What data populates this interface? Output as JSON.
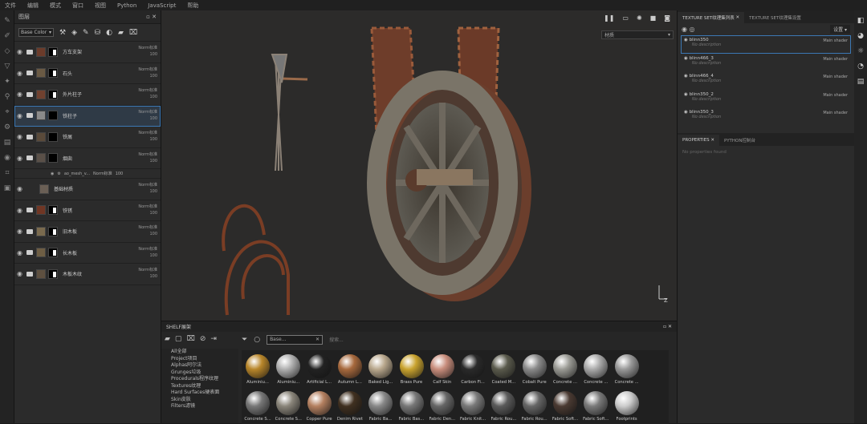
{
  "menu": [
    "文件",
    "编辑",
    "模式",
    "窗口",
    "视图",
    "Python",
    "JavaScript",
    "帮助"
  ],
  "layers": {
    "title": "图层",
    "channel": "Base Color",
    "items": [
      {
        "name": "方车支架",
        "blend": "Norm标准",
        "op": "100",
        "thumb": "#6b3b2a",
        "mask": "white"
      },
      {
        "name": "石头",
        "blend": "Norm标准",
        "op": "100",
        "thumb": "#6a5a44",
        "mask": "white"
      },
      {
        "name": "外片柱子",
        "blend": "Norm标准",
        "op": "100",
        "thumb": "#70412f",
        "mask": "white"
      },
      {
        "name": "铁柱子",
        "blend": "Norm标准",
        "op": "100",
        "thumb": "#8a8a8a",
        "mask": "black"
      },
      {
        "name": "铁屑",
        "blend": "Norm标准",
        "op": "100",
        "thumb": "#5a4a3a",
        "mask": "black"
      },
      {
        "name": "烟囱",
        "blend": "Norm标准",
        "op": "100",
        "thumb": "#5a5048",
        "mask": "black"
      },
      {
        "name": "基础材质",
        "blend": "Norm标准",
        "op": "100",
        "thumb": "#6a5f55",
        "mask": "none"
      },
      {
        "name": "铁锈",
        "blend": "Norm标准",
        "op": "100",
        "thumb": "#703624",
        "mask": "white"
      },
      {
        "name": "旧木板",
        "blend": "Norm标准",
        "op": "100",
        "thumb": "#7a6a4e",
        "mask": "white"
      },
      {
        "name": "长木板",
        "blend": "Norm标准",
        "op": "100",
        "thumb": "#6e5e44",
        "mask": "white"
      },
      {
        "name": "木板木纹",
        "blend": "Norm标准",
        "op": "100",
        "thumb": "#5e5040",
        "mask": "white"
      }
    ],
    "sublayer": {
      "name": "ao_mesh_v...",
      "blend": "Norm标准",
      "op": "100"
    }
  },
  "viewport": {
    "dropdown": "材质"
  },
  "shelf": {
    "title": "SHELF展架",
    "search": "搜索...",
    "filter": "Base...",
    "categories": [
      "All全部",
      "Project项目",
      "Alphas阿尔法",
      "Grunges垃圾",
      "Procedurals程序纹理",
      "Textures纹理",
      "Hard Surfaces硬表面",
      "Skin皮肤",
      "Filters滤镜"
    ],
    "materials": [
      {
        "name": "Aluminiu...",
        "c": "#b8862a"
      },
      {
        "name": "Aluminiu...",
        "c": "#b0b0b0"
      },
      {
        "name": "Artificial L...",
        "c": "#222"
      },
      {
        "name": "Autumn L...",
        "c": "#a7693d"
      },
      {
        "name": "Baked Lig...",
        "c": "#b9a88d"
      },
      {
        "name": "Brass Pure",
        "c": "#c9a32f"
      },
      {
        "name": "Calf Skin",
        "c": "#c88d7c"
      },
      {
        "name": "Carbon Fi...",
        "c": "#2a2a2a"
      },
      {
        "name": "Coated M...",
        "c": "#5a5a4c"
      },
      {
        "name": "Cobalt Pure",
        "c": "#8a8a8a"
      },
      {
        "name": "Concrete ...",
        "c": "#9a9a94"
      },
      {
        "name": "Concrete ...",
        "c": "#aaa"
      },
      {
        "name": "Concrete ...",
        "c": "#999"
      },
      {
        "name": "Concrete S...",
        "c": "#777"
      },
      {
        "name": "Concrete S...",
        "c": "#8a857a"
      },
      {
        "name": "Copper Pure",
        "c": "#b48060"
      },
      {
        "name": "Denim Rivet",
        "c": "#403020"
      },
      {
        "name": "Fabric Ba...",
        "c": "#888"
      },
      {
        "name": "Fabric Bas...",
        "c": "#777"
      },
      {
        "name": "Fabric Den...",
        "c": "#666"
      },
      {
        "name": "Fabric Knit...",
        "c": "#797979"
      },
      {
        "name": "Fabric Rou...",
        "c": "#5a5a5a"
      },
      {
        "name": "Fabric Rou...",
        "c": "#666"
      },
      {
        "name": "Fabric Soft...",
        "c": "#4a3a32"
      },
      {
        "name": "Fabric Soft...",
        "c": "#7a7a7a"
      },
      {
        "name": "Footprints",
        "c": "#ccc"
      }
    ]
  },
  "texset": {
    "tab1": "TEXTURE SET纹理集列表",
    "tab2": "TEXTURE SET纹理集设置",
    "settings": "设置",
    "items": [
      {
        "name": "blinn350",
        "desc": "No description",
        "shader": "Main shader"
      },
      {
        "name": "blinn466_3",
        "desc": "No description",
        "shader": "Main shader"
      },
      {
        "name": "blinn466_4",
        "desc": "No description",
        "shader": "Main shader"
      },
      {
        "name": "blinn350_2",
        "desc": "No description",
        "shader": "Main shader"
      },
      {
        "name": "blinn350_3",
        "desc": "No description",
        "shader": "Main shader"
      }
    ]
  },
  "props": {
    "tab1": "PROPERTIES",
    "tab2": "PYTHON控制台",
    "empty": "No properties found"
  }
}
